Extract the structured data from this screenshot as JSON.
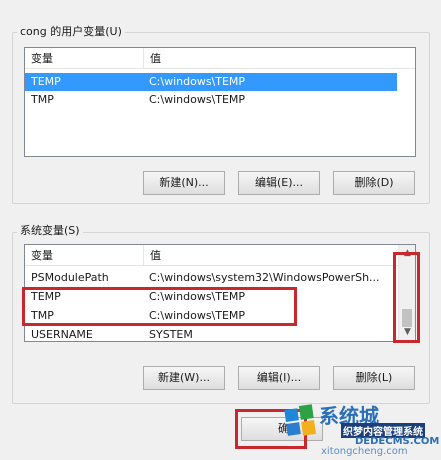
{
  "user_vars": {
    "group_label": "cong 的用户变量(U)",
    "columns": [
      "变量",
      "值"
    ],
    "rows": [
      {
        "name": "TEMP",
        "value": "C:\\windows\\TEMP",
        "selected": true
      },
      {
        "name": "TMP",
        "value": "C:\\windows\\TEMP",
        "selected": false
      }
    ],
    "buttons": {
      "new": "新建(N)...",
      "edit": "编辑(E)...",
      "delete": "删除(D)"
    }
  },
  "system_vars": {
    "group_label": "系统变量(S)",
    "columns": [
      "变量",
      "值"
    ],
    "rows": [
      {
        "name": "PSModulePath",
        "value": "C:\\windows\\system32\\WindowsPowerSh..."
      },
      {
        "name": "TEMP",
        "value": "C:\\windows\\TEMP"
      },
      {
        "name": "TMP",
        "value": "C:\\windows\\TEMP"
      },
      {
        "name": "USERNAME",
        "value": "SYSTEM"
      }
    ],
    "buttons": {
      "new": "新建(W)...",
      "edit": "编辑(I)...",
      "delete": "删除(L)"
    }
  },
  "dialog": {
    "ok_label": "确"
  },
  "watermark": {
    "brand": "系统城",
    "subtitle": "织梦内容管理系统",
    "url1": "DEDECMS.COM",
    "url2": "xitongcheng.com"
  },
  "colors": {
    "selection": "#3399ff",
    "highlight": "#c8272d"
  }
}
